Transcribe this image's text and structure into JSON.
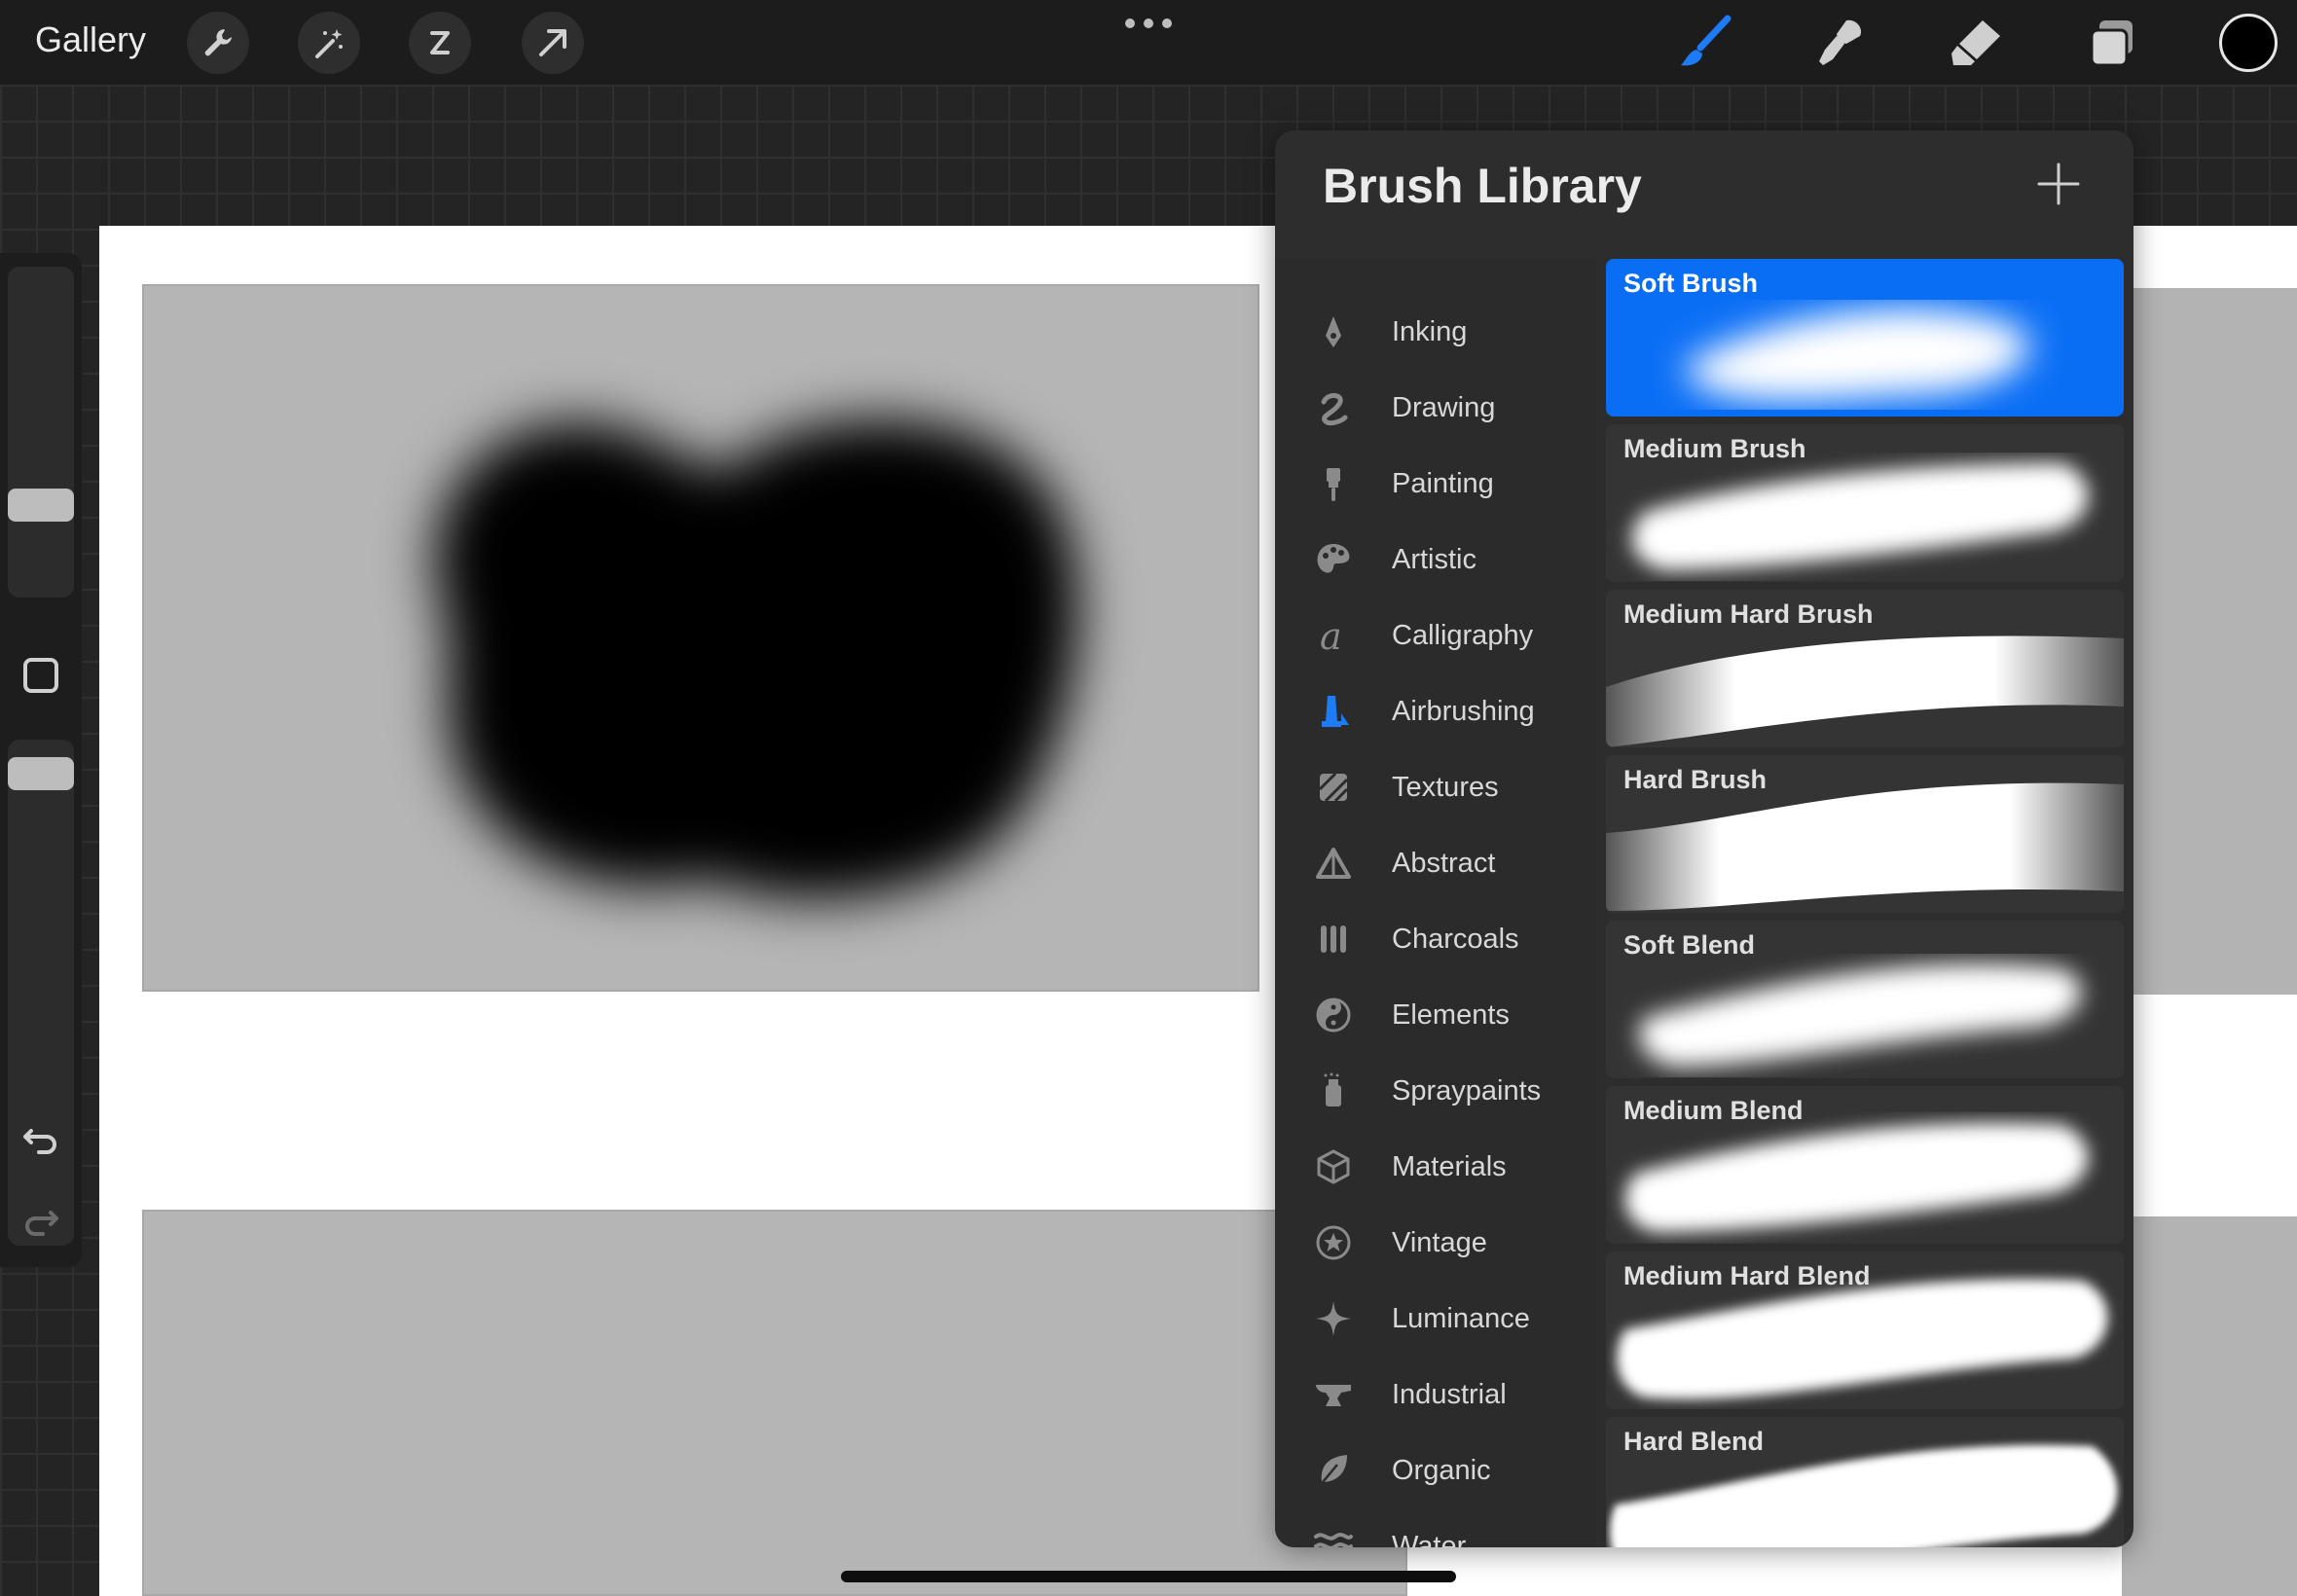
{
  "topbar": {
    "gallery_label": "Gallery",
    "left_tools": [
      "wrench-icon",
      "magic-wand-icon",
      "selection-icon",
      "transform-arrow-icon"
    ],
    "right_tools": [
      "brush-icon",
      "smudge-icon",
      "eraser-icon",
      "layers-icon"
    ],
    "active_tool": "brush-icon",
    "current_color": "#000000",
    "accent_color": "#0a6ef5"
  },
  "sidebar": {
    "icons": [
      "modify-square-icon",
      "undo-icon",
      "redo-icon"
    ]
  },
  "library": {
    "title": "Brush Library",
    "add_icon": "plus-icon",
    "categories": [
      {
        "label": "Inking",
        "icon": "pen-nib-icon"
      },
      {
        "label": "Drawing",
        "icon": "squiggle-icon"
      },
      {
        "label": "Painting",
        "icon": "paintbrush-icon"
      },
      {
        "label": "Artistic",
        "icon": "palette-icon"
      },
      {
        "label": "Calligraphy",
        "icon": "calligraphy-a-icon"
      },
      {
        "label": "Airbrushing",
        "icon": "airbrush-icon"
      },
      {
        "label": "Textures",
        "icon": "texture-icon"
      },
      {
        "label": "Abstract",
        "icon": "triangle-icon"
      },
      {
        "label": "Charcoals",
        "icon": "charcoal-sticks-icon"
      },
      {
        "label": "Elements",
        "icon": "yin-yang-icon"
      },
      {
        "label": "Spraypaints",
        "icon": "spray-can-icon"
      },
      {
        "label": "Materials",
        "icon": "cube-icon"
      },
      {
        "label": "Vintage",
        "icon": "star-badge-icon"
      },
      {
        "label": "Luminance",
        "icon": "sparkle-icon"
      },
      {
        "label": "Industrial",
        "icon": "anvil-icon"
      },
      {
        "label": "Organic",
        "icon": "leaf-icon"
      },
      {
        "label": "Water",
        "icon": "waves-icon"
      }
    ],
    "active_category": "Airbrushing",
    "brushes": [
      {
        "name": "Soft Brush"
      },
      {
        "name": "Medium Brush"
      },
      {
        "name": "Medium Hard Brush"
      },
      {
        "name": "Hard Brush"
      },
      {
        "name": "Soft Blend"
      },
      {
        "name": "Medium Blend"
      },
      {
        "name": "Medium Hard Blend"
      },
      {
        "name": "Hard Blend"
      }
    ],
    "selected_brush": "Soft Brush"
  }
}
